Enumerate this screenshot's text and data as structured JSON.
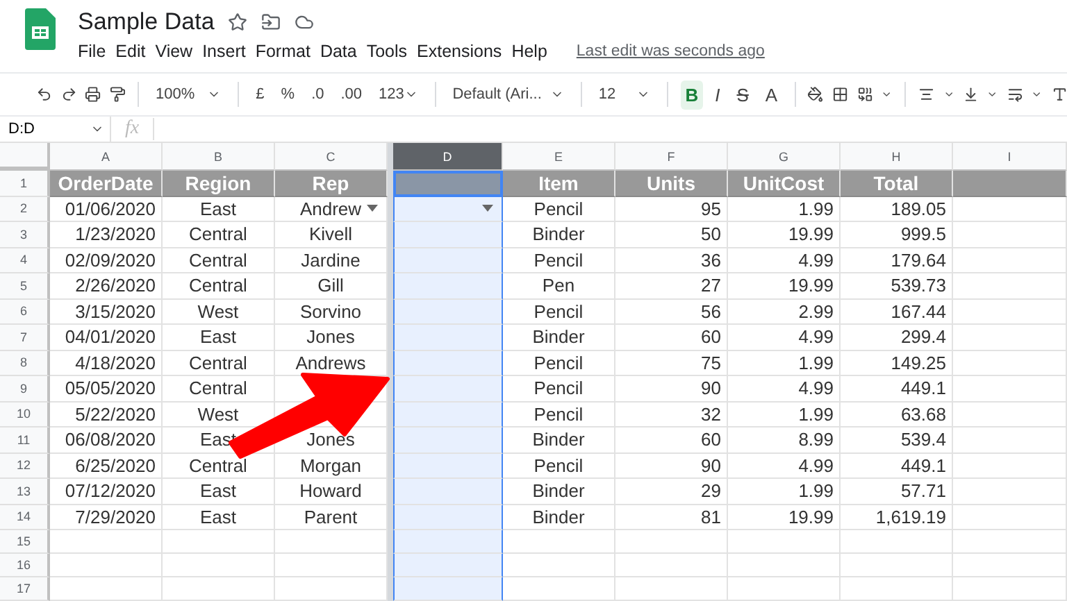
{
  "document": {
    "title": "Sample Data"
  },
  "menu": [
    "File",
    "Edit",
    "View",
    "Insert",
    "Format",
    "Data",
    "Tools",
    "Extensions",
    "Help"
  ],
  "last_edit": "Last edit was seconds ago",
  "toolbar": {
    "zoom": "100%",
    "currency": "£",
    "percent": "%",
    "decrease_decimals": ".0",
    "increase_decimals": ".00",
    "number_format": "123",
    "font": "Default (Ari...",
    "font_size": "12",
    "bold": {
      "label": "B",
      "on": true
    },
    "italic": "I",
    "strikethrough": "S",
    "text_color": "A"
  },
  "name_box": "D:D",
  "formula_icon": "fx",
  "columns": [
    {
      "letter": "A",
      "selected": false
    },
    {
      "letter": "B",
      "selected": false
    },
    {
      "letter": "C",
      "selected": false
    },
    {
      "letter": "D",
      "selected": true
    },
    {
      "letter": "E",
      "selected": false
    },
    {
      "letter": "F",
      "selected": false
    },
    {
      "letter": "G",
      "selected": false
    },
    {
      "letter": "H",
      "selected": false
    },
    {
      "letter": "I",
      "selected": false
    }
  ],
  "rows": [
    {
      "number": "1",
      "kind": "header",
      "cells": [
        "OrderDate",
        "Region",
        "Rep",
        null,
        "Item",
        "Units",
        "UnitCost",
        "Total",
        null
      ]
    },
    {
      "number": "2",
      "kind": "data",
      "cells": [
        "01/06/2020",
        "East",
        {
          "text": "Andrew",
          "dropdown": true
        },
        {
          "dropdown": true
        },
        "Pencil",
        "95",
        "1.99",
        "189.05",
        null
      ]
    },
    {
      "number": "3",
      "kind": "data",
      "cells": [
        "1/23/2020",
        "Central",
        "Kivell",
        null,
        "Binder",
        "50",
        "19.99",
        "999.5",
        null
      ]
    },
    {
      "number": "4",
      "kind": "data",
      "cells": [
        "02/09/2020",
        "Central",
        "Jardine",
        null,
        "Pencil",
        "36",
        "4.99",
        "179.64",
        null
      ]
    },
    {
      "number": "5",
      "kind": "data",
      "cells": [
        "2/26/2020",
        "Central",
        "Gill",
        null,
        "Pen",
        "27",
        "19.99",
        "539.73",
        null
      ]
    },
    {
      "number": "6",
      "kind": "data",
      "cells": [
        "3/15/2020",
        "West",
        "Sorvino",
        null,
        "Pencil",
        "56",
        "2.99",
        "167.44",
        null
      ]
    },
    {
      "number": "7",
      "kind": "data",
      "cells": [
        "04/01/2020",
        "East",
        "Jones",
        null,
        "Binder",
        "60",
        "4.99",
        "299.4",
        null
      ]
    },
    {
      "number": "8",
      "kind": "data",
      "cells": [
        "4/18/2020",
        "Central",
        "Andrews",
        null,
        "Pencil",
        "75",
        "1.99",
        "149.25",
        null
      ]
    },
    {
      "number": "9",
      "kind": "data",
      "cells": [
        "05/05/2020",
        "Central",
        null,
        null,
        "Pencil",
        "90",
        "4.99",
        "449.1",
        null
      ]
    },
    {
      "number": "10",
      "kind": "data",
      "cells": [
        "5/22/2020",
        "West",
        null,
        null,
        "Pencil",
        "32",
        "1.99",
        "63.68",
        null
      ]
    },
    {
      "number": "11",
      "kind": "data",
      "cells": [
        "06/08/2020",
        "East",
        "Jones",
        null,
        "Binder",
        "60",
        "8.99",
        "539.4",
        null
      ]
    },
    {
      "number": "12",
      "kind": "data",
      "cells": [
        "6/25/2020",
        "Central",
        "Morgan",
        null,
        "Pencil",
        "90",
        "4.99",
        "449.1",
        null
      ]
    },
    {
      "number": "13",
      "kind": "data",
      "cells": [
        "07/12/2020",
        "East",
        "Howard",
        null,
        "Binder",
        "29",
        "1.99",
        "57.71",
        null
      ]
    },
    {
      "number": "14",
      "kind": "data",
      "cells": [
        "7/29/2020",
        "East",
        "Parent",
        null,
        "Binder",
        "81",
        "19.99",
        "1,619.19",
        null
      ]
    },
    {
      "number": "15",
      "kind": "empty",
      "cells": []
    },
    {
      "number": "16",
      "kind": "empty",
      "cells": []
    },
    {
      "number": "17",
      "kind": "empty",
      "cells": []
    }
  ]
}
